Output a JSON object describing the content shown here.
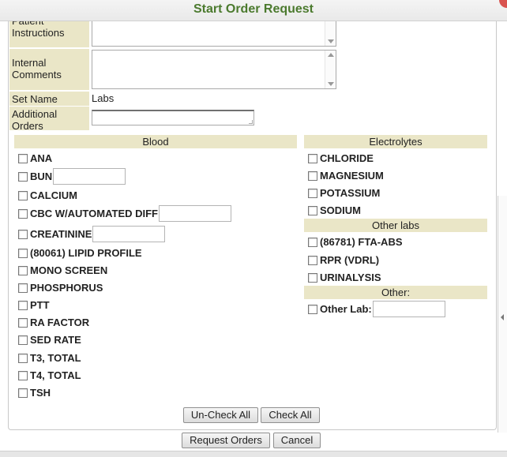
{
  "dialog": {
    "title": "Start Order Request"
  },
  "fields": {
    "patient_instructions_label": "Patient Instructions",
    "internal_comments_label": "Internal Comments",
    "set_name_label": "Set Name",
    "set_name_value": "Labs",
    "additional_orders_label": "Additional Orders"
  },
  "blood": {
    "heading": "Blood",
    "items": [
      "ANA",
      "BUN",
      "CALCIUM",
      "CBC W/AUTOMATED DIFF",
      "CREATININE",
      "(80061) LIPID PROFILE",
      "MONO SCREEN",
      "PHOSPHORUS",
      "PTT",
      "RA FACTOR",
      "SED RATE",
      "T3, TOTAL",
      "T4, TOTAL",
      "TSH"
    ]
  },
  "electrolytes": {
    "heading": "Electrolytes",
    "items": [
      "CHLORIDE",
      "MAGNESIUM",
      "POTASSIUM",
      "SODIUM"
    ]
  },
  "other_labs": {
    "heading": "Other labs",
    "items": [
      "(86781) FTA-ABS",
      "RPR (VDRL)",
      "URINALYSIS"
    ]
  },
  "other": {
    "heading": "Other:",
    "item": "Other Lab:"
  },
  "buttons": {
    "uncheck_all": "Un-Check All",
    "check_all": "Check All",
    "request_orders": "Request Orders",
    "cancel": "Cancel"
  }
}
